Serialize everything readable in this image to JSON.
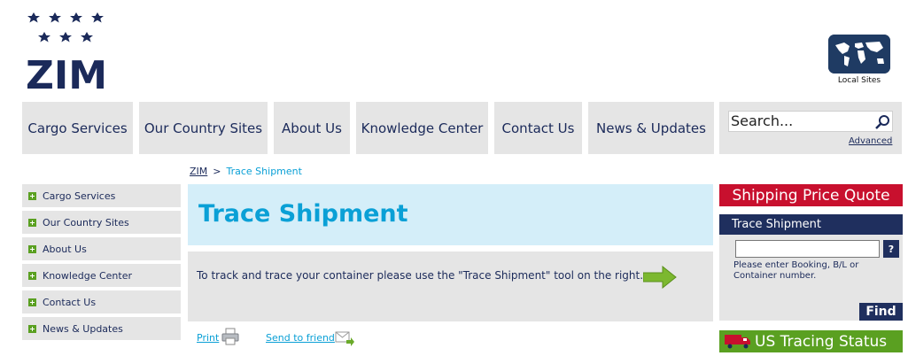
{
  "logo": {
    "text": "ZIM"
  },
  "local_sites": {
    "label": "Local Sites"
  },
  "topnav": {
    "items": [
      {
        "label": "Cargo Services"
      },
      {
        "label": "Our Country Sites"
      },
      {
        "label": "About Us"
      },
      {
        "label": "Knowledge Center"
      },
      {
        "label": "Contact Us"
      },
      {
        "label": "News & Updates"
      }
    ]
  },
  "search": {
    "placeholder": "Search...",
    "value": "Search...",
    "advanced": "Advanced"
  },
  "breadcrumb": {
    "root": "ZIM",
    "separator": ">",
    "current": "Trace Shipment"
  },
  "leftnav": {
    "items": [
      {
        "label": "Cargo Services"
      },
      {
        "label": "Our Country Sites"
      },
      {
        "label": "About Us"
      },
      {
        "label": "Knowledge Center"
      },
      {
        "label": "Contact Us"
      },
      {
        "label": "News & Updates"
      }
    ]
  },
  "main": {
    "title": "Trace Shipment",
    "text": "To track and trace your container please use the \"Trace Shipment\" tool on the right.",
    "print": "Print",
    "send": "Send to friend"
  },
  "sidebar": {
    "quote": "Shipping Price Quote",
    "trace_title": "Trace Shipment",
    "trace_help_button": "?",
    "trace_help": "Please enter Booking, B/L or Container number.",
    "find": "Find",
    "us_status": "US Tracing Status"
  },
  "colors": {
    "navy": "#1b2a5a",
    "accent_blue": "#0aa0d6",
    "quote_red": "#c8102e",
    "status_green": "#5aa021",
    "panel_gray": "#e5e5e5"
  }
}
